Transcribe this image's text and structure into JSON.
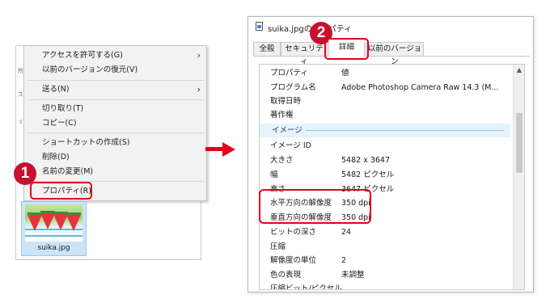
{
  "explorer": {
    "fragments": [
      "所",
      "ス",
      "ゞ"
    ],
    "context_menu": [
      {
        "label": "アクセスを許可する(G)",
        "submenu": true
      },
      {
        "label": "以前のバージョンの復元(V)",
        "submenu": false
      },
      {
        "label": "送る(N)",
        "submenu": true
      },
      {
        "label": "切り取り(T)",
        "submenu": false
      },
      {
        "label": "コピー(C)",
        "submenu": false
      },
      {
        "label": "ショートカットの作成(S)",
        "submenu": false
      },
      {
        "label": "削除(D)",
        "submenu": false
      },
      {
        "label": "名前の変更(M)",
        "submenu": false
      },
      {
        "label": "プロパティ(R)",
        "submenu": false
      }
    ],
    "file_name": "suika.jpg"
  },
  "steps": [
    "1",
    "2"
  ],
  "dialog": {
    "title": "suika.jpgのプロパティ",
    "tabs": [
      "全般",
      "セキュリティ",
      "詳細",
      "以前のバージョン"
    ],
    "active_tab": "詳細",
    "header": {
      "name": "プロパティ",
      "value": "値"
    },
    "rows": [
      {
        "name": "プログラム名",
        "value": "Adobe Photoshop Camera Raw 14.3 (M..."
      },
      {
        "name": "取得日時",
        "value": ""
      },
      {
        "name": "著作権",
        "value": ""
      },
      {
        "group": "イメージ"
      },
      {
        "name": "イメージ ID",
        "value": ""
      },
      {
        "name": "大きさ",
        "value": "5482 x 3647"
      },
      {
        "name": "幅",
        "value": "5482 ピクセル"
      },
      {
        "name": "高さ",
        "value": "3647 ピクセル"
      },
      {
        "name": "水平方向の解像度",
        "value": "350 dpi"
      },
      {
        "name": "垂直方向の解像度",
        "value": "350 dpi"
      },
      {
        "name": "ビットの深さ",
        "value": "24"
      },
      {
        "name": "圧縮",
        "value": ""
      },
      {
        "name": "解像度の単位",
        "value": "2"
      },
      {
        "name": "色の表現",
        "value": "未調整"
      },
      {
        "name": "圧縮ビット/ピクセル",
        "value": ""
      }
    ]
  },
  "colors": {
    "highlight": "#e3001b",
    "badge": "#c8102e"
  }
}
